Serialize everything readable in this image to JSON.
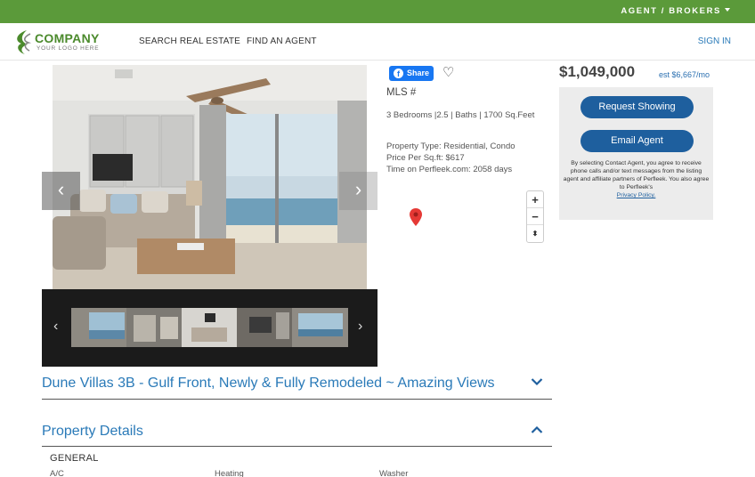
{
  "topbar": {
    "agent_label": "AGENT / BROKERS"
  },
  "nav": {
    "logo_name": "COMPANY",
    "logo_tagline": "YOUR LOGO HERE",
    "search_label": "SEARCH REAL ESTATE",
    "find_agent_label": "FIND AN AGENT",
    "signin_label": "SIGN IN"
  },
  "gallery": {
    "prev_glyph": "‹",
    "next_glyph": "›",
    "thumb_prev_glyph": "‹",
    "thumb_next_glyph": "›"
  },
  "listing": {
    "share_label": "Share",
    "mls_label": "MLS #",
    "facts": "3 Bedrooms |2.5 | Baths | 1700 Sq.Feet",
    "property_type": "Property Type: Residential, Condo",
    "price_per_sqft": "Price Per Sq.ft: $617",
    "time_on_site": "Time on Perfleek.com: 2058 days",
    "price": "$1,049,000",
    "est_payment": "est $6,667/mo",
    "title": "Dune Villas 3B - Gulf Front, Newly & Fully Remodeled ~ Amazing Views"
  },
  "map": {
    "zoom_in": "+",
    "zoom_out": "−",
    "compass": "⬍"
  },
  "contact": {
    "request_label": "Request Showing",
    "email_label": "Email Agent",
    "disclaimer": "By selecting Contact Agent, you agree to receive phone calls and/or text messages from the listing agent and affiliate partners of Perfleek. You also agree to Perfleek's",
    "privacy_label": "Privacy Policy."
  },
  "details": {
    "heading": "Property Details",
    "section": "GENERAL",
    "labels": [
      "A/C",
      "Heating",
      "Washer"
    ]
  },
  "colors": {
    "topbar": "#5b9a3a",
    "brand_green": "#4b8a2c",
    "primary_blue": "#1e5f9e",
    "link_blue": "#2a7ab8",
    "facebook": "#1877f2",
    "pin_red": "#e53935"
  }
}
